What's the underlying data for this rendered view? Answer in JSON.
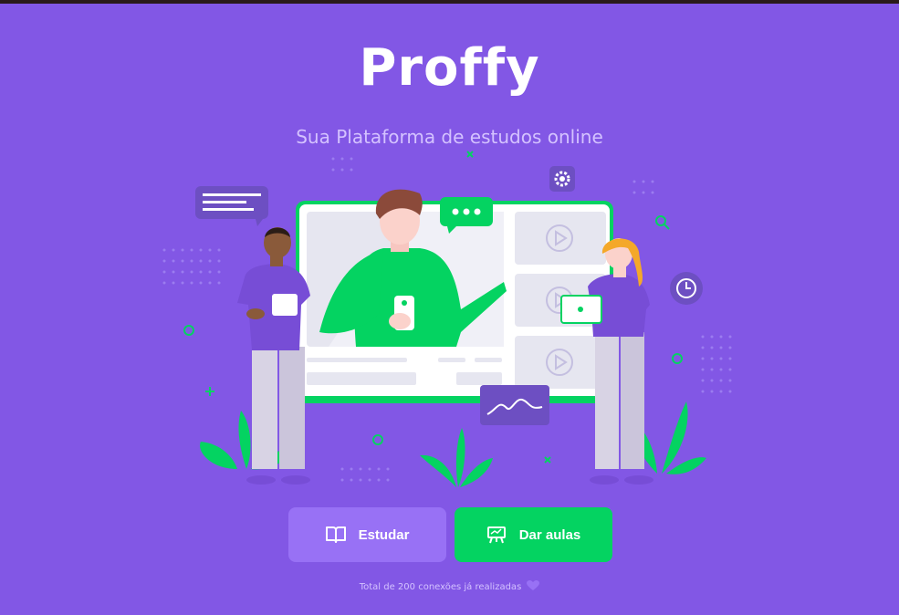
{
  "brand": {
    "logo_text": "Proffy",
    "tagline": "Sua Plataforma de estudos online"
  },
  "actions": {
    "study_label": "Estudar",
    "teach_label": "Dar aulas"
  },
  "footer": {
    "connections_text": "Total de 200 conexões já realizadas"
  },
  "icons": {
    "study": "book-icon",
    "teach": "presentation-icon",
    "heart": "heart-icon"
  },
  "colors": {
    "primary": "#8257e5",
    "primary_light": "#9871f5",
    "secondary": "#04d361",
    "text_in_primary": "#d4c2ff"
  }
}
